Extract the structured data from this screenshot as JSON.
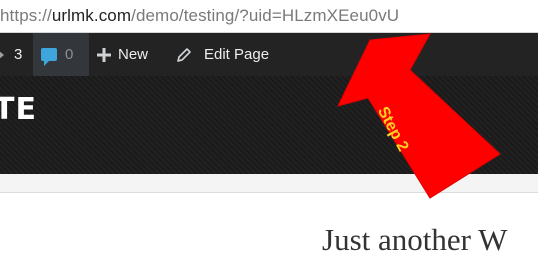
{
  "browser": {
    "url_prefix": "https://",
    "url_domain": "urlmk.com",
    "url_path": "/demo/testing/?uid=HLzmXEeu0vU"
  },
  "admin_bar": {
    "updates_count": "3",
    "comments_count": "0",
    "new_label": "New",
    "edit_label": "Edit Page"
  },
  "site": {
    "title_fragment": "TE",
    "tagline": "Just another W"
  },
  "annotation": {
    "label": "Step 2",
    "arrow_color": "#ff0000",
    "text_color": "#ffd21f"
  },
  "colors": {
    "admin_bar_bg": "#232323",
    "header_bg": "#1c1c1c",
    "comment_accent": "#3ea6dc"
  },
  "icons": [
    "updates-icon",
    "comment-bubble-icon",
    "plus-icon",
    "pencil-icon"
  ]
}
